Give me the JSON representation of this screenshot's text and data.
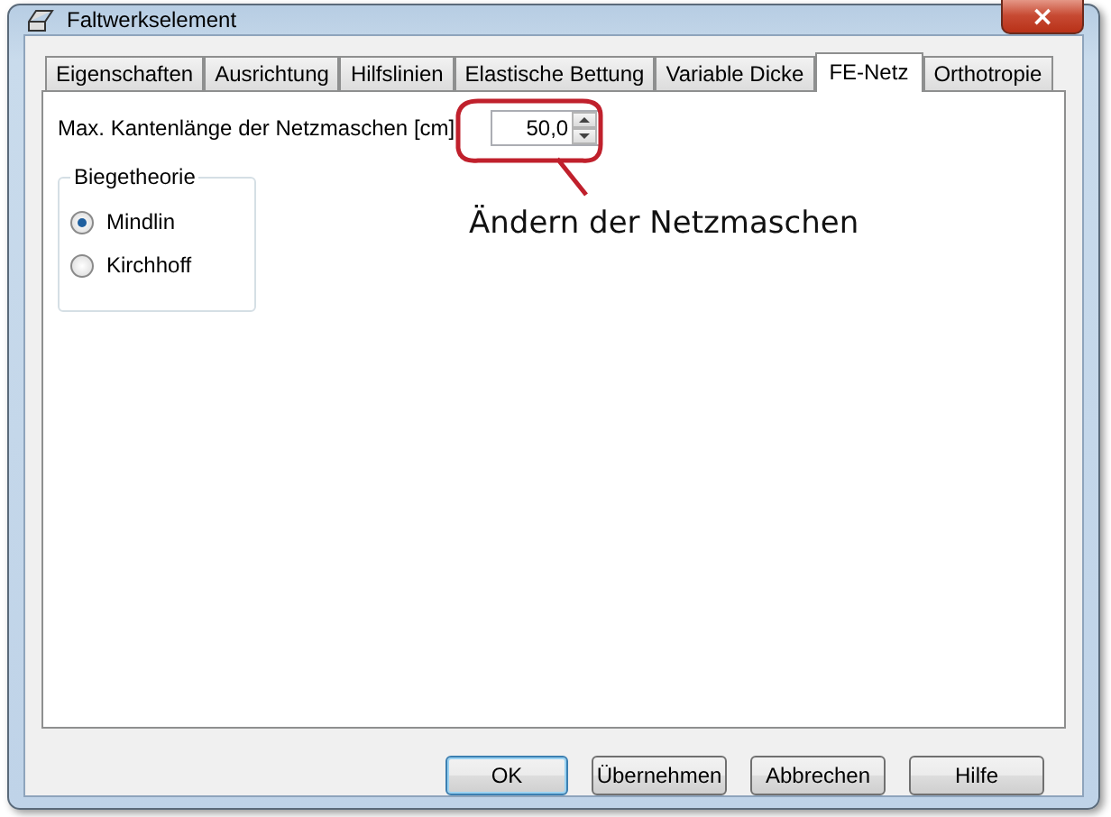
{
  "window": {
    "title": "Faltwerkselement",
    "close": "×"
  },
  "tabs": [
    {
      "label": "Eigenschaften",
      "selected": false
    },
    {
      "label": "Ausrichtung",
      "selected": false
    },
    {
      "label": "Hilfslinien",
      "selected": false
    },
    {
      "label": "Elastische Bettung",
      "selected": false
    },
    {
      "label": "Variable Dicke",
      "selected": false
    },
    {
      "label": "FE-Netz",
      "selected": true
    },
    {
      "label": "Orthotropie",
      "selected": false
    }
  ],
  "mesh_length": {
    "label": "Max. Kantenlänge der Netzmaschen [cm]",
    "value": "50,0"
  },
  "bending_theory": {
    "title": "Biegetheorie",
    "options": [
      {
        "label": "Mindlin",
        "selected": true
      },
      {
        "label": "Kirchhoff",
        "selected": false
      }
    ]
  },
  "annotation": {
    "text": "Ändern der Netzmaschen"
  },
  "buttons": [
    {
      "label": "OK",
      "default": true
    },
    {
      "label": "Übernehmen",
      "default": false
    },
    {
      "label": "Abbrechen",
      "default": false
    },
    {
      "label": "Hilfe",
      "default": false
    }
  ]
}
